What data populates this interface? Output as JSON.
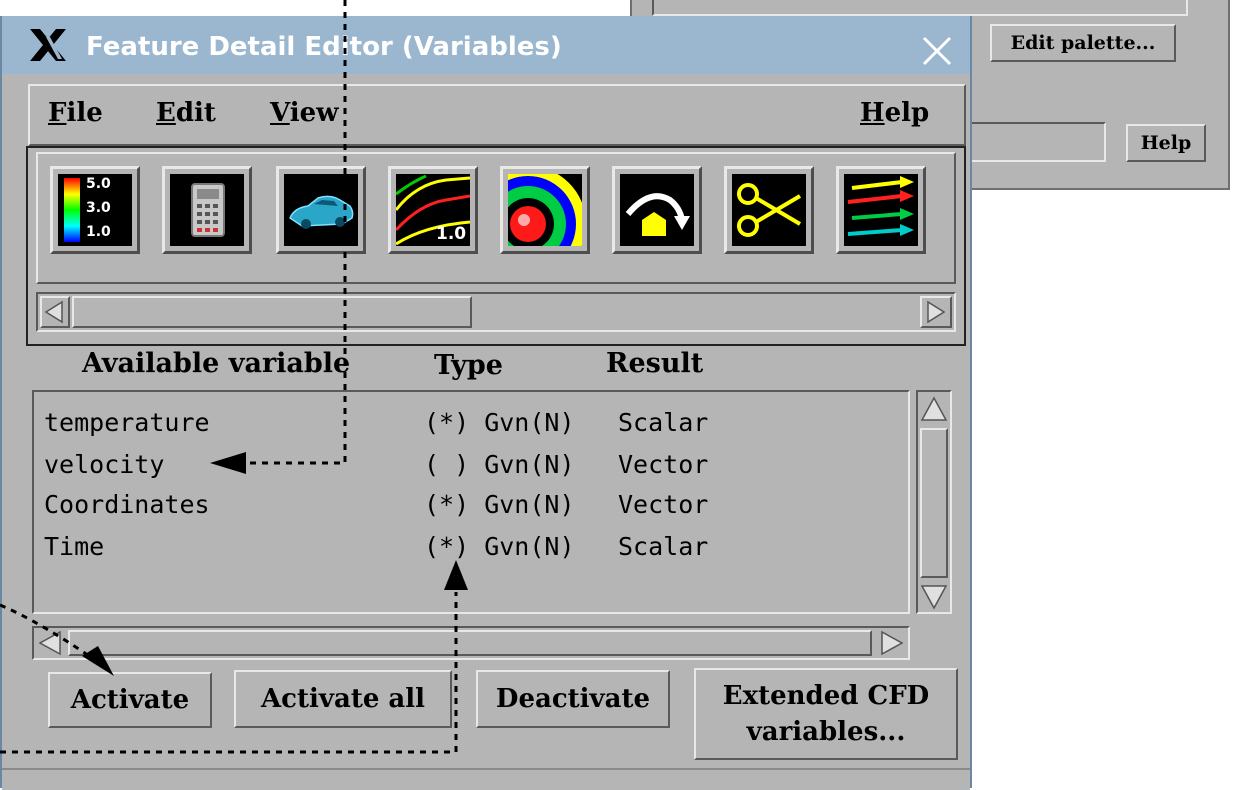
{
  "window_title": "Feature Detail Editor (Variables)",
  "background_window": {
    "edit_palette_label": "Edit palette...",
    "help_label": "Help"
  },
  "menubar": {
    "file": {
      "label": "File",
      "mnemonic": "F",
      "rest": "ile"
    },
    "edit": {
      "label": "Edit",
      "mnemonic": "E",
      "rest": "dit"
    },
    "view": {
      "label": "View",
      "mnemonic": "V",
      "rest": "iew"
    },
    "help": {
      "label": "Help",
      "mnemonic": "H",
      "rest": "elp"
    }
  },
  "toolbar_icons": [
    {
      "name": "color-legend-icon",
      "labels": [
        "5.0",
        "3.0",
        "1.0"
      ]
    },
    {
      "name": "calculator-icon"
    },
    {
      "name": "car-model-icon"
    },
    {
      "name": "contour-lines-icon",
      "label": "1.0"
    },
    {
      "name": "isosurface-icon"
    },
    {
      "name": "particle-trace-icon"
    },
    {
      "name": "clip-scissors-icon"
    },
    {
      "name": "vector-arrows-icon"
    }
  ],
  "table": {
    "headers": {
      "variable": "Available variable",
      "type": "Type",
      "result": "Result"
    },
    "rows": [
      {
        "name": "temperature",
        "type": "(*) Gvn(N)",
        "result": "Scalar"
      },
      {
        "name": "velocity",
        "type": "( ) Gvn(N)",
        "result": "Vector"
      },
      {
        "name": "Coordinates",
        "type": "(*) Gvn(N)",
        "result": "Vector"
      },
      {
        "name": "Time",
        "type": "(*) Gvn(N)",
        "result": "Scalar"
      }
    ]
  },
  "buttons": {
    "activate": "Activate",
    "activate_all": "Activate all",
    "deactivate": "Deactivate",
    "extended_line1": "Extended CFD",
    "extended_line2": "variables..."
  },
  "colors": {
    "titlebar": "#9ab7cf",
    "panel": "#b5b5b5",
    "annotation_line": "#000000"
  }
}
